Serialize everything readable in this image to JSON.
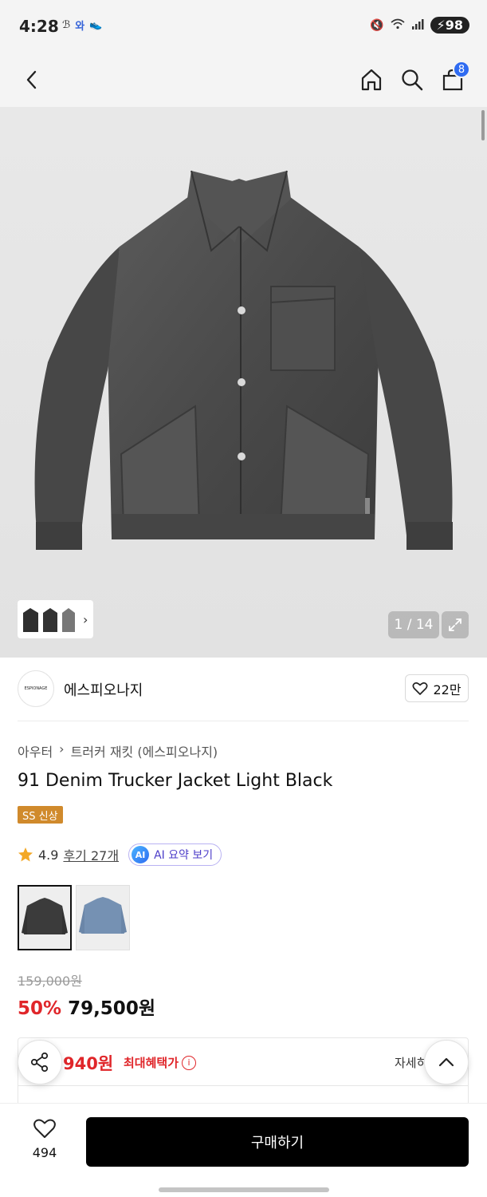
{
  "status_bar": {
    "time": "4:28",
    "left_icons": [
      "accessibility-icon",
      "ai-icon",
      "shoe-icon"
    ],
    "right_icons": [
      "mute-icon",
      "wifi-icon",
      "signal-icon"
    ],
    "battery": "98"
  },
  "nav": {
    "cart_count": "8"
  },
  "gallery": {
    "counter": "1 / 14"
  },
  "brand": {
    "logo_text": "ESPIONAGE",
    "name": "에스피오나지",
    "likes": "22만"
  },
  "breadcrumb": {
    "category": "아우터",
    "subcategory": "트러커 재킷 (에스피오나지)"
  },
  "product": {
    "title": "91 Denim Trucker Jacket Light Black",
    "tag": "SS 신상",
    "rating": "4.9",
    "reviews": "후기 27개",
    "ai_summary": "AI 요약 보기",
    "ai_badge": "AI"
  },
  "pricing": {
    "original": "159,000원",
    "discount": "50%",
    "price": "79,500원"
  },
  "benefit": {
    "amount": "940원",
    "label": "최대혜택가",
    "detail": "자세히"
  },
  "bottom": {
    "wish_count": "494",
    "buy_label": "구매하기"
  },
  "colors": {
    "accent_blue": "#2f6bf1",
    "sale_red": "#e0262a",
    "tag_orange": "#d08a2c"
  }
}
